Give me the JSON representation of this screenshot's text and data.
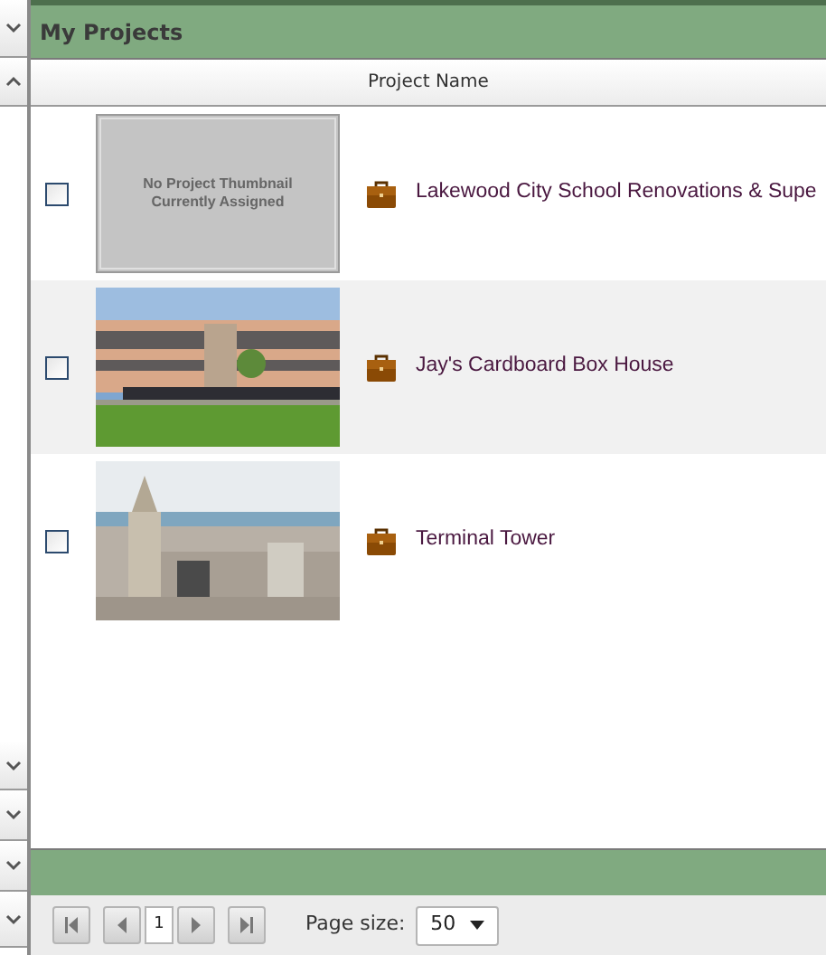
{
  "panel": {
    "title": "My Projects"
  },
  "side_buttons": [
    {
      "kind": "down"
    },
    {
      "kind": "up"
    },
    {
      "kind": "down"
    },
    {
      "kind": "down"
    },
    {
      "kind": "down"
    },
    {
      "kind": "down"
    }
  ],
  "table": {
    "columns": [
      "Project Name"
    ],
    "rows": [
      {
        "checked": false,
        "thumbnail": {
          "kind": "placeholder",
          "text": "No Project Thumbnail Currently Assigned"
        },
        "name": "Lakewood City School Renovations & Supe"
      },
      {
        "checked": false,
        "thumbnail": {
          "kind": "building"
        },
        "name": "Jay's Cardboard Box House"
      },
      {
        "checked": false,
        "thumbnail": {
          "kind": "city"
        },
        "name": "Terminal Tower"
      }
    ]
  },
  "pager": {
    "page": "1",
    "page_size_label": "Page size:",
    "page_size": "50"
  }
}
